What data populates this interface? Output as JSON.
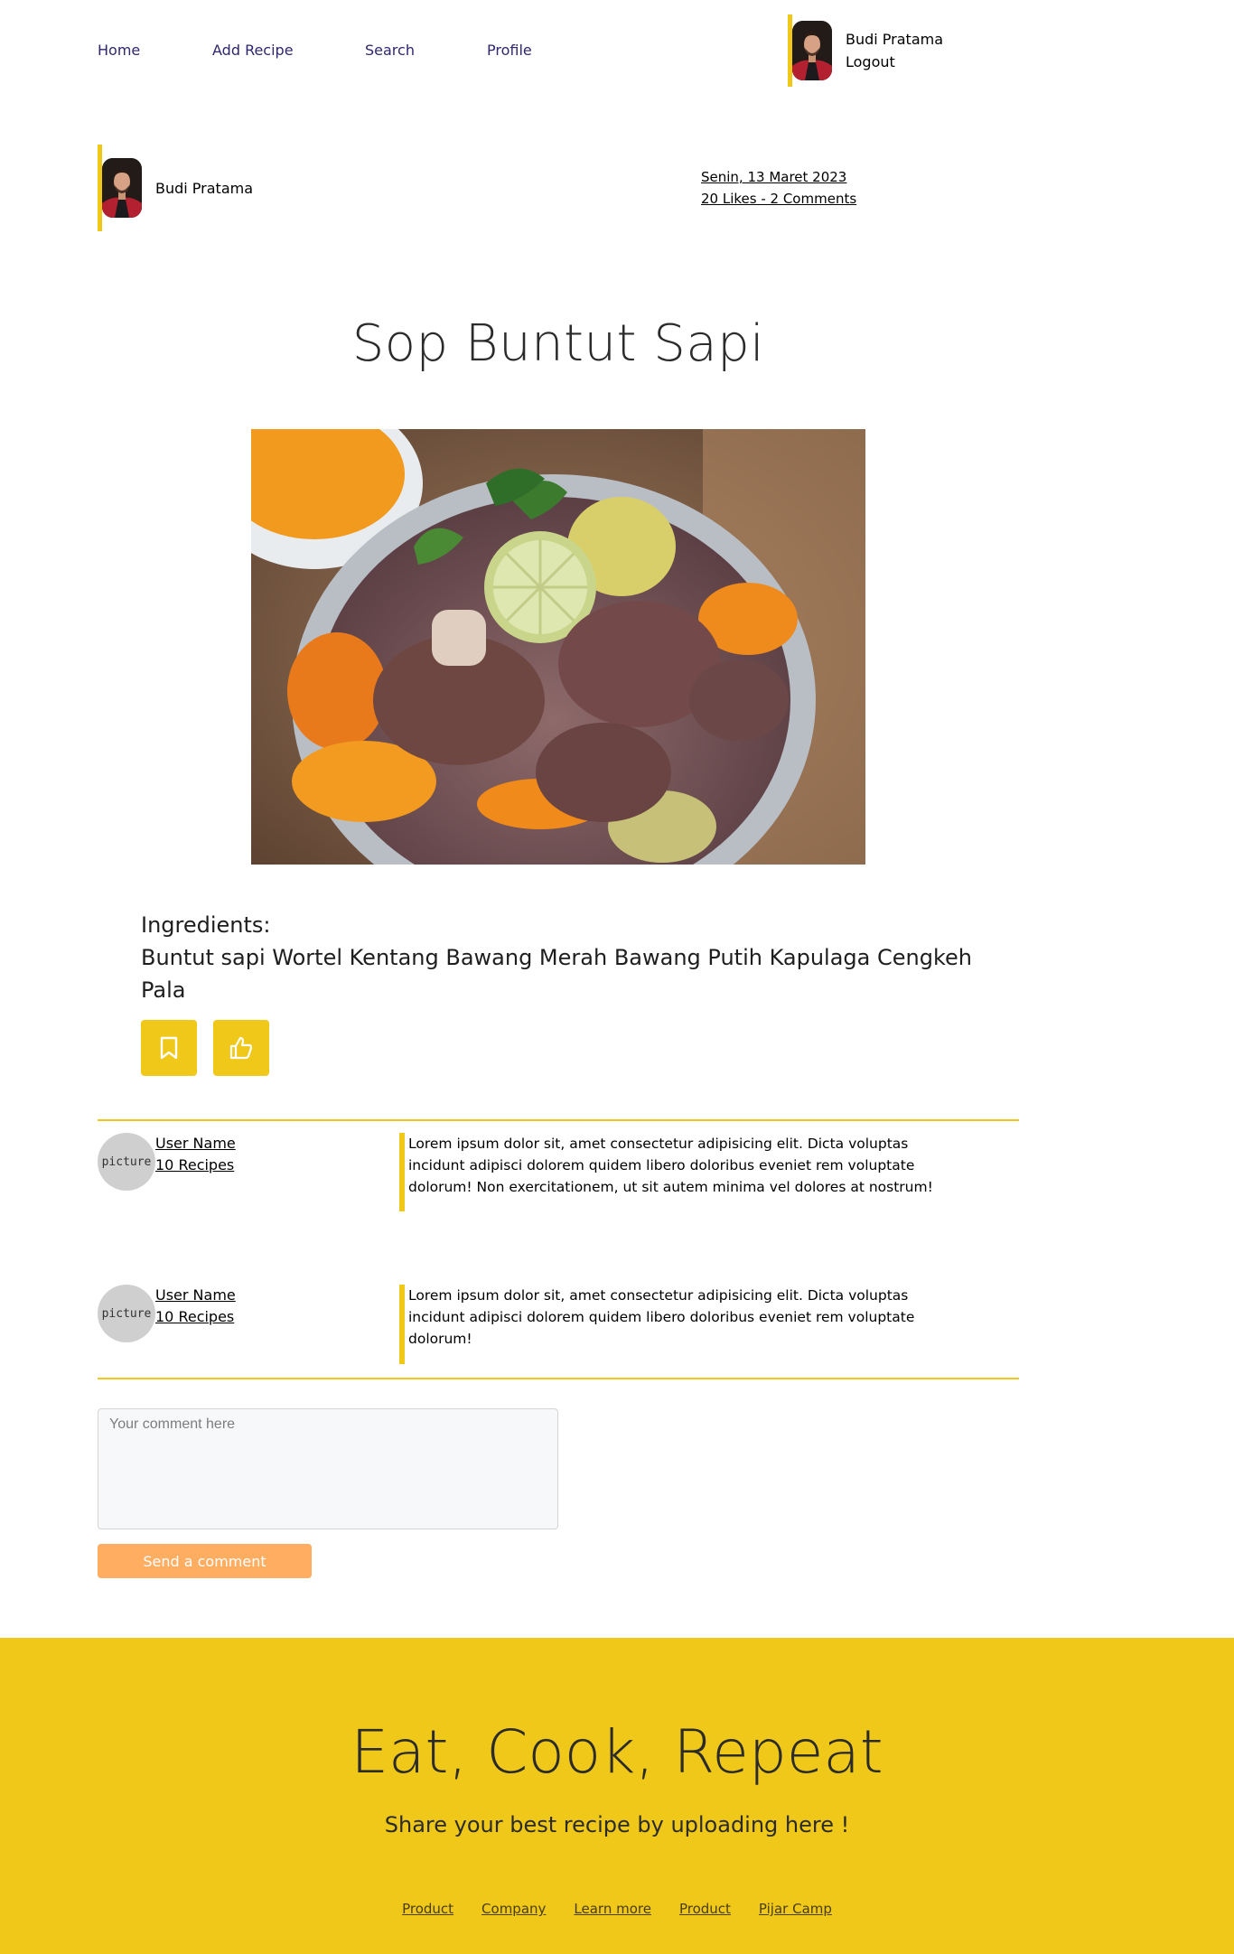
{
  "nav": {
    "links": [
      "Home",
      "Add Recipe",
      "Search",
      "Profile"
    ],
    "user_name": "Budi Pratama",
    "logout": "Logout"
  },
  "author": {
    "name": "Budi Pratama",
    "date": "Senin, 13 Maret 2023",
    "stats": "20 Likes - 2 Comments"
  },
  "recipe": {
    "title": "Sop Buntut Sapi",
    "ingredients_label": "Ingredients:",
    "ingredients": "Buntut sapi Wortel Kentang Bawang Merah Bawang Putih Kapulaga Cengkeh Pala"
  },
  "actions": {
    "icons": [
      "bookmark-icon",
      "thumbs-up-icon"
    ]
  },
  "comments": [
    {
      "avatar_text": "picture",
      "user": "User Name",
      "recipes": "10 Recipes",
      "text": "Lorem ipsum dolor sit, amet consectetur adipisicing elit. Dicta voluptas incidunt adipisci dolorem quidem libero doloribus eveniet rem voluptate dolorum! Non exercitationem, ut sit autem minima vel dolores at nostrum!"
    },
    {
      "avatar_text": "picture",
      "user": "User Name",
      "recipes": "10 Recipes",
      "text": "Lorem ipsum dolor sit, amet consectetur adipisicing elit. Dicta voluptas incidunt adipisci dolorem quidem libero doloribus eveniet rem voluptate dolorum!"
    }
  ],
  "comment_form": {
    "placeholder": "Your comment here",
    "send_label": "Send a comment"
  },
  "footer": {
    "title": "Eat, Cook, Repeat",
    "subtitle": "Share your best recipe by uploading here !",
    "links": [
      "Product",
      "Company",
      "Learn more",
      "Product",
      "Pijar Camp"
    ]
  },
  "colors": {
    "accent": "#efc81a",
    "send_button": "#ffad60",
    "nav_link": "#2e266f"
  }
}
